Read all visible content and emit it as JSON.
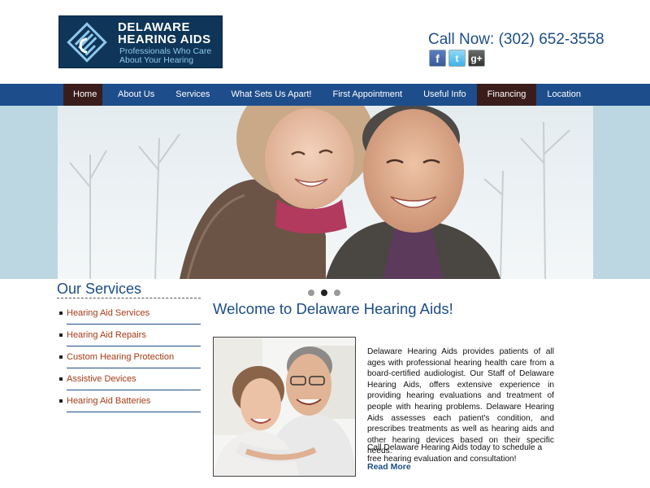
{
  "logo": {
    "line1": "DELAWARE",
    "line2": "HEARING AIDS",
    "tagline1": "Professionals Who Care",
    "tagline2": "About Your Hearing",
    "bg_color": "#0f3558"
  },
  "header": {
    "call_now": "Call Now: (302) 652-3558",
    "social": {
      "facebook": "f",
      "twitter": "t",
      "google_plus": "g+"
    }
  },
  "nav": {
    "items": [
      "Home",
      "About Us",
      "Services",
      "What Sets Us Apart!",
      "First Appointment",
      "Useful Info",
      "Financing",
      "Location"
    ],
    "highlighted": [
      "Home",
      "Financing"
    ],
    "bar_color": "#1e4d8b",
    "highlight_color": "#3a1d1b"
  },
  "slider": {
    "slide_count": 3,
    "active_index": 1
  },
  "sidebar": {
    "title": "Our Services",
    "items": [
      "Hearing Aid Services",
      "Hearing Aid Repairs",
      "Custom Hearing Protection",
      "Assistive Devices",
      "Hearing Aid Batteries"
    ]
  },
  "main": {
    "heading": "Welcome to Delaware Hearing Aids!",
    "body": "Delaware Hearing Aids provides patients of all ages with professional hearing health care from a board-certified audiologist. Our Staff of Delaware Hearing Aids, offers extensive experience in providing hearing evaluations and treatment of people with hearing problems. Delaware Hearing Aids assesses each patient's condition, and prescribes treatments as well as hearing aids and other hearing devices based on their specific needs.",
    "call_to_action": "Call Delaware Hearing Aids today to schedule a free hearing evaluation and consultation!",
    "read_more": "Read More"
  },
  "colors": {
    "accent_blue": "#1c4d86",
    "link_orange": "#a53a14",
    "hero_band": "#bcd7e1"
  }
}
